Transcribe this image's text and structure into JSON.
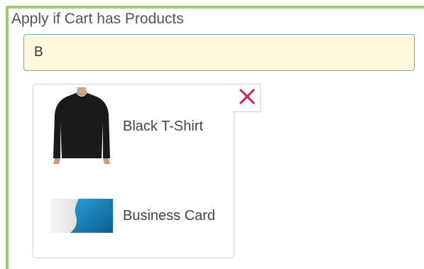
{
  "rule": {
    "label": "Apply if Cart has Products"
  },
  "search": {
    "value": "B"
  },
  "results": [
    {
      "name": "Black T-Shirt",
      "icon": "black-tshirt-image"
    },
    {
      "name": "Business Card",
      "icon": "business-card-image"
    }
  ],
  "close": {
    "icon": "close-icon",
    "color": "#d81b60"
  },
  "colors": {
    "accent": "#9ccc65",
    "input_bg": "#fff9dc",
    "input_border": "#7aa7d6"
  }
}
